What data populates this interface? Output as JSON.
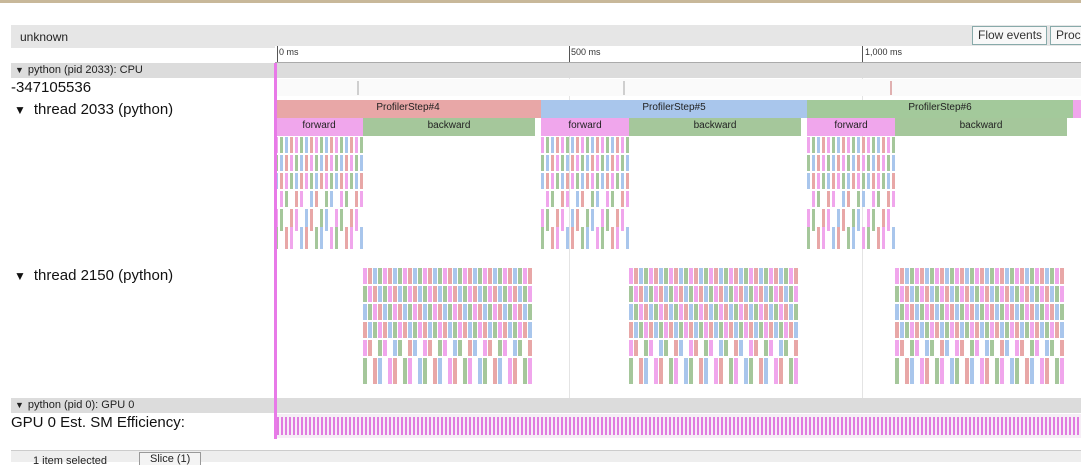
{
  "window": {
    "title": "unknown"
  },
  "toolbar": {
    "flow_events_label": "Flow events",
    "processes_label": "Proc"
  },
  "ruler": {
    "ticks": [
      "0 ms",
      "500 ms",
      "1,000 ms"
    ]
  },
  "cpu_process": {
    "header": "python (pid 2033): CPU",
    "counter_value": "-347105536",
    "thread_main": {
      "label": "thread 2033 (python)",
      "steps": [
        "ProfilerStep#4",
        "ProfilerStep#5",
        "ProfilerStep#6"
      ],
      "forward_label": "forward",
      "backward_label": "backward"
    },
    "thread_backward": {
      "label": "thread 2150 (python)"
    }
  },
  "gpu_process": {
    "header": "python (pid 0): GPU 0",
    "counter_label": "GPU 0 Est. SM Efficiency:"
  },
  "status": {
    "selected_text": "1 item selected",
    "slice_tab": "Slice (1)"
  },
  "colors": {
    "step_a": "#e8a7a7",
    "step_b": "#a9c6ec",
    "step_c": "#a3c99b",
    "forward": "#f0a6ec",
    "backward": "#a5c79b",
    "selection": "#e87ae8"
  }
}
